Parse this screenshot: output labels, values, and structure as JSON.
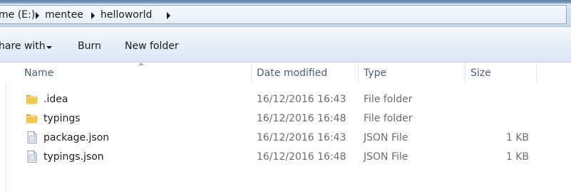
{
  "address_bar": {
    "crumbs": [
      "me (E:)",
      "mentee",
      "helloworld"
    ]
  },
  "toolbar": {
    "share_label": "hare with",
    "burn_label": "Burn",
    "new_folder_label": "New folder"
  },
  "columns": {
    "name": "Name",
    "date_modified": "Date modified",
    "type": "Type",
    "size": "Size"
  },
  "files": [
    {
      "name": ".idea",
      "date": "16/12/2016 16:43",
      "type": "File folder",
      "size": "",
      "icon": "folder-icon"
    },
    {
      "name": "typings",
      "date": "16/12/2016 16:48",
      "type": "File folder",
      "size": "",
      "icon": "folder-icon"
    },
    {
      "name": "package.json",
      "date": "16/12/2016 16:43",
      "type": "JSON File",
      "size": "1 KB",
      "icon": "file-icon"
    },
    {
      "name": "typings.json",
      "date": "16/12/2016 16:48",
      "type": "JSON File",
      "size": "1 KB",
      "icon": "file-icon"
    }
  ],
  "colors": {
    "folder_yellow": "#f2c94c",
    "header_text": "#4c607a",
    "meta_text": "#6d6d6d"
  }
}
